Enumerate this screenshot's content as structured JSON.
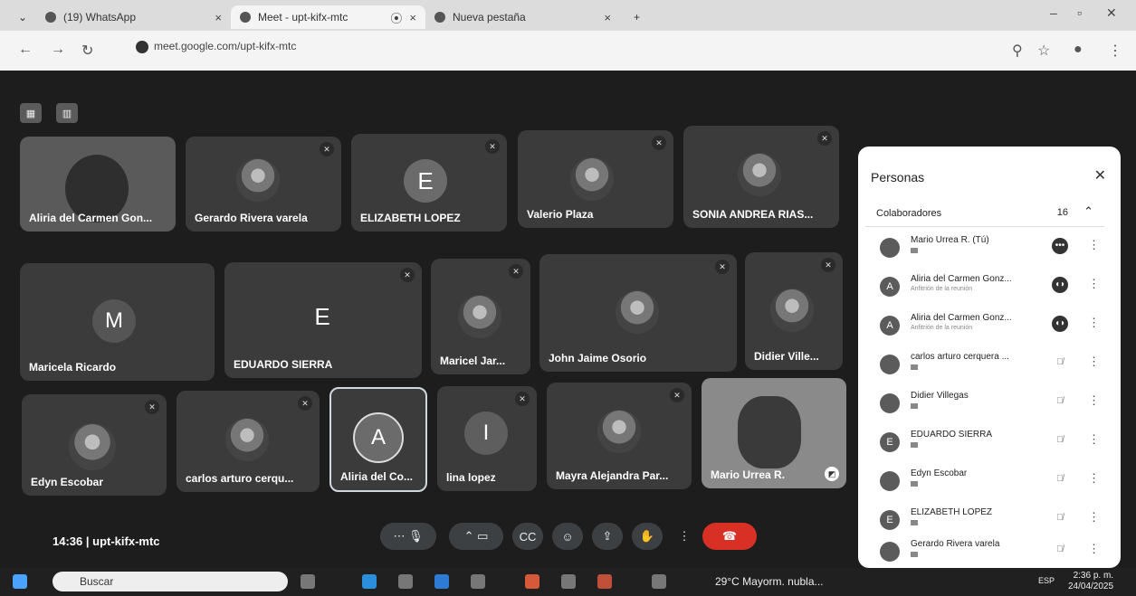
{
  "browser": {
    "tabs": [
      {
        "label": "(19) WhatsApp",
        "active": false
      },
      {
        "label": "Meet - upt-kifx-mtc",
        "active": true
      },
      {
        "label": "Nueva pestaña",
        "active": false
      }
    ],
    "url": "meet.google.com/upt-kifx-mtc"
  },
  "meet": {
    "tiles": [
      {
        "name": "Aliria del Carmen Gon...",
        "avatar": "photo"
      },
      {
        "name": "Gerardo Rivera varela",
        "avatar": "photo"
      },
      {
        "name": "ELIZABETH LOPEZ",
        "avatar": "E"
      },
      {
        "name": "Valerio Plaza",
        "avatar": "photo"
      },
      {
        "name": "SONIA ANDREA RIAS...",
        "avatar": "photo"
      },
      {
        "name": "Maricela Ricardo",
        "avatar": "M"
      },
      {
        "name": "EDUARDO SIERRA",
        "avatar": "E"
      },
      {
        "name": "Maricel Jar...",
        "avatar": "photo"
      },
      {
        "name": "John Jaime Osorio",
        "avatar": "photo"
      },
      {
        "name": "Didier Ville...",
        "avatar": "photo"
      },
      {
        "name": "Edyn Escobar",
        "avatar": "photo"
      },
      {
        "name": "carlos arturo cerqu...",
        "avatar": "photo"
      },
      {
        "name": "Aliria del Co...",
        "avatar": "A"
      },
      {
        "name": "lina lopez",
        "avatar": "I"
      },
      {
        "name": "Mayra Alejandra Par...",
        "avatar": "photo"
      },
      {
        "name": "Mario Urrea R.",
        "avatar": "photo"
      }
    ],
    "time": "14:36",
    "meeting_code": "upt-kifx-mtc",
    "participants_badge": "16"
  },
  "people_panel": {
    "title": "Personas",
    "section_label": "Colaboradores",
    "count": "16",
    "people": [
      {
        "name": "Mario Urrea R. (Tú)",
        "sub": "",
        "initial": "",
        "mic": "active"
      },
      {
        "name": "Aliria del Carmen Gonz...",
        "sub": "Anfitrión de la reunión",
        "initial": "A",
        "mic": "active"
      },
      {
        "name": "Aliria del Carmen Gonz...",
        "sub": "Anfitrión de la reunión",
        "initial": "A",
        "mic": "active"
      },
      {
        "name": "carlos arturo cerquera ...",
        "sub": "",
        "initial": "",
        "mic": "muted"
      },
      {
        "name": "Didier Villegas",
        "sub": "",
        "initial": "",
        "mic": "muted"
      },
      {
        "name": "EDUARDO SIERRA",
        "sub": "",
        "initial": "E",
        "mic": "muted"
      },
      {
        "name": "Edyn Escobar",
        "sub": "",
        "initial": "",
        "mic": "muted"
      },
      {
        "name": "ELIZABETH LOPEZ",
        "sub": "",
        "initial": "E",
        "mic": "muted"
      },
      {
        "name": "Gerardo Rivera varela",
        "sub": "",
        "initial": "",
        "mic": "muted"
      }
    ]
  },
  "taskbar": {
    "search_placeholder": "Buscar",
    "weather": "29°C  Mayorm. nubla...",
    "language": "ESP",
    "time": "2:36 p. m.",
    "date": "24/04/2025"
  }
}
